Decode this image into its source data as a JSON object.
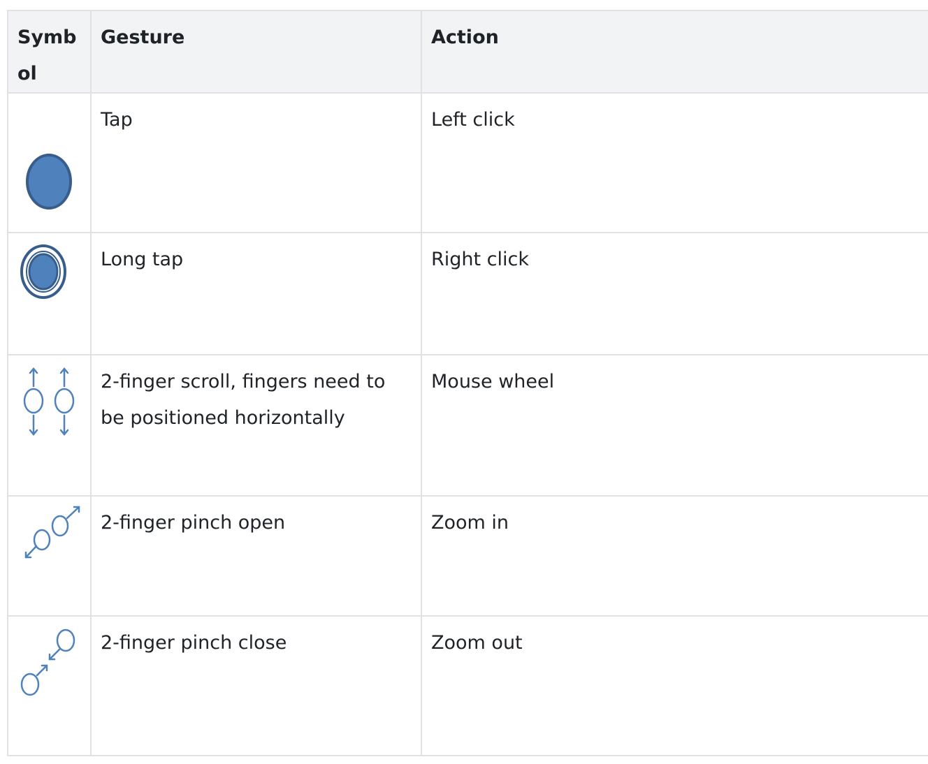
{
  "table": {
    "headers": {
      "symbol": "Symbol",
      "gesture": "Gesture",
      "action": "Action"
    },
    "rows": [
      {
        "icon": "tap-icon",
        "gesture": "Tap",
        "action": "Left click"
      },
      {
        "icon": "long-tap-icon",
        "gesture": "Long tap",
        "action": "Right click"
      },
      {
        "icon": "two-finger-scroll-icon",
        "gesture": "2-finger scroll, fingers need to be positioned horizontally",
        "action": "Mouse wheel"
      },
      {
        "icon": "pinch-open-icon",
        "gesture": "2-finger pinch open",
        "action": "Zoom in"
      },
      {
        "icon": "pinch-close-icon",
        "gesture": "2-finger pinch close",
        "action": "Zoom out"
      }
    ]
  },
  "colors": {
    "icon_fill": "#4f81bd",
    "icon_stroke": "#385d8a",
    "header_bg": "#f2f3f5",
    "border": "#dfe1e4"
  }
}
